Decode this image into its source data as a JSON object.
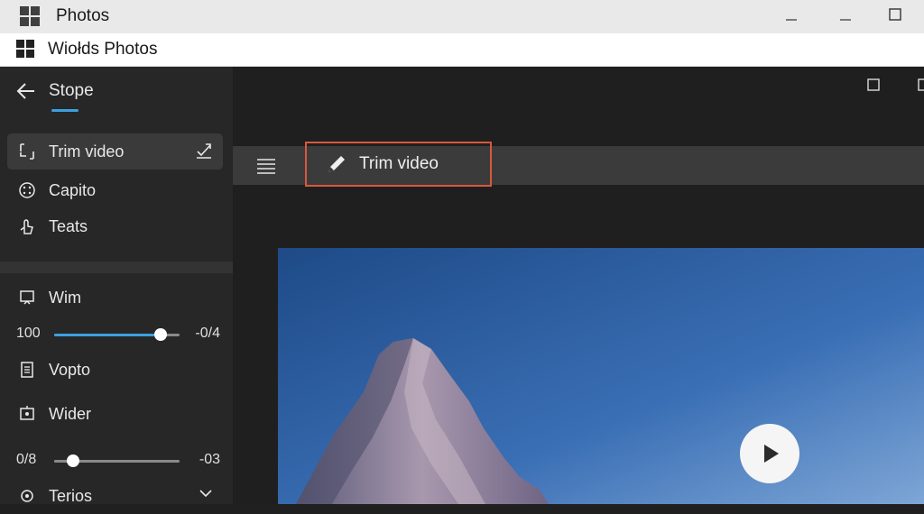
{
  "window": {
    "title": "Photos"
  },
  "appbar": {
    "title": "Wiołds Photos"
  },
  "sidebar": {
    "back_label": "Stope",
    "items": [
      {
        "label": "Trim video",
        "icon": "trim-icon",
        "selected": true
      },
      {
        "label": "Capito",
        "icon": "dots-circle-icon"
      },
      {
        "label": "Teats",
        "icon": "hand-pointer-icon"
      }
    ],
    "items2": [
      {
        "label": "Wim",
        "icon": "screen-crop-icon"
      },
      {
        "label": "Vopto",
        "icon": "document-icon"
      },
      {
        "label": "Wider",
        "icon": "frame-icon"
      },
      {
        "label": "Terios",
        "icon": "gear-icon"
      }
    ],
    "slider1": {
      "left": "100",
      "right": "-0/4",
      "level": 0.85
    },
    "slider2": {
      "left": "0/8",
      "right": "-03",
      "level": 0.15
    }
  },
  "toolbar": {
    "trim_label": "Trim video"
  },
  "colors": {
    "accent": "#3d9fe0",
    "highlight": "#d9583c",
    "sidebar_bg": "#272727",
    "toolbar_bg": "#3b3b3b"
  }
}
